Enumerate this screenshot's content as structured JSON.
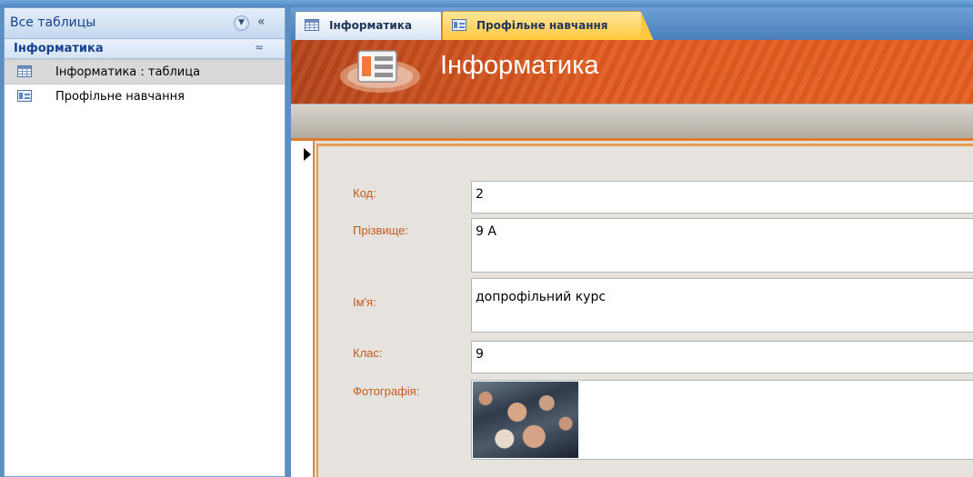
{
  "nav_pane": {
    "title": "Все таблицы",
    "menu_icon": "chevron-down-circle-icon",
    "collapse_icon": "double-chevron-left-icon",
    "collapse_glyph": "«",
    "group": {
      "title": "Інформатика",
      "collapse_glyph": "≈"
    },
    "items": [
      {
        "label": "Інформатика : таблица",
        "icon": "table-icon",
        "selected": true
      },
      {
        "label": "Профільне навчання",
        "icon": "form-icon",
        "selected": false
      }
    ]
  },
  "tabs": [
    {
      "label": "Інформатика",
      "icon": "table-icon",
      "active": false
    },
    {
      "label": "Профільне навчання",
      "icon": "form-icon",
      "active": true
    }
  ],
  "form": {
    "header_title": "Інформатика",
    "fields": [
      {
        "label": "Код:",
        "value": "2"
      },
      {
        "label": "Прізвище:",
        "value": "9 А"
      },
      {
        "label": "Ім'я:",
        "value": "допрофільний курс"
      },
      {
        "label": "Клас:",
        "value": "9"
      },
      {
        "label": "Фотографія:",
        "value": ""
      }
    ]
  },
  "colors": {
    "header_orange": "#e15a1f",
    "label_orange": "#c35a1c",
    "nav_blue": "#15428b",
    "active_tab": "#ffc83e"
  }
}
